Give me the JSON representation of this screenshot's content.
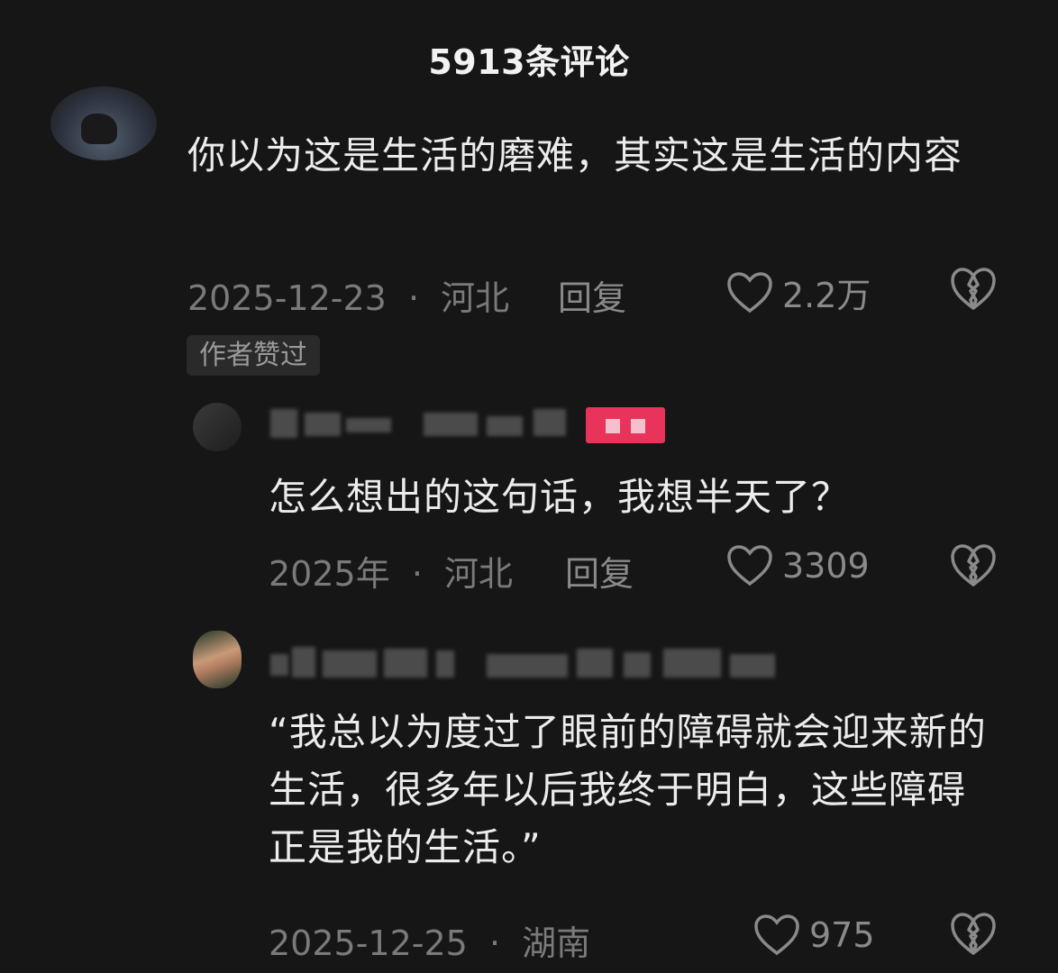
{
  "header": {
    "title": "5913条评论"
  },
  "colors": {
    "background": "#161616",
    "text": "#ececec",
    "meta": "#7a7a7a",
    "badge_pink": "#e8335a"
  },
  "comments": [
    {
      "text": "你以为这是生活的磨难，其实这是生活的内容",
      "date": "2025-12-23",
      "location": "河北",
      "reply_label": "回复",
      "likes": "2.2万",
      "author_badge": "作者赞过"
    },
    {
      "text": "怎么想出的这句话，我想半天了？",
      "date": "2025年",
      "location": "河北",
      "reply_label": "回复",
      "likes": "3309"
    },
    {
      "text": "“我总以为度过了眼前的障碍就会迎来新的生活，很多年以后我终于明白，这些障碍正是我的生活。”",
      "date": "2025-12-25",
      "location": "湖南",
      "likes": "975"
    }
  ],
  "icons": {
    "like": "heart-outline-icon",
    "dislike": "broken-heart-icon"
  },
  "separator": "·"
}
